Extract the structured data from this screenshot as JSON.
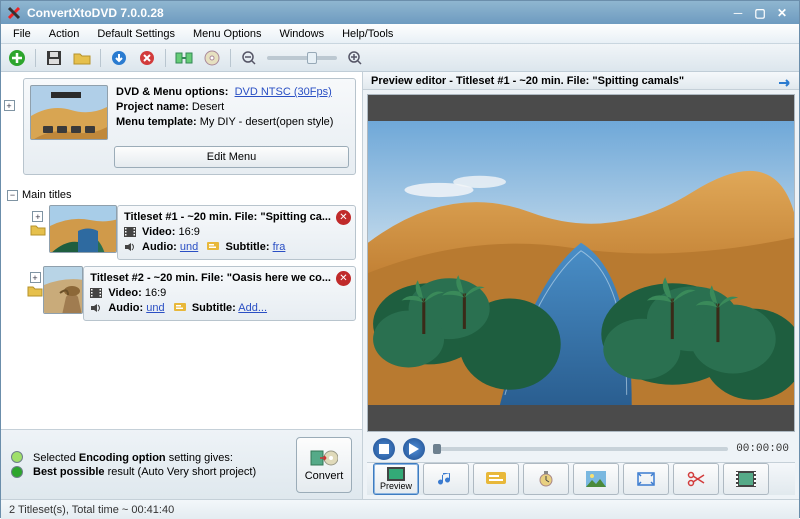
{
  "window": {
    "title": "ConvertXtoDVD 7.0.0.28"
  },
  "menu": {
    "file": "File",
    "action": "Action",
    "default_settings": "Default Settings",
    "menu_options": "Menu Options",
    "windows": "Windows",
    "help_tools": "Help/Tools"
  },
  "dvd": {
    "options_label": "DVD & Menu options:",
    "options_value": "DVD NTSC (30Fps)",
    "project_label": "Project name:",
    "project_value": "Desert",
    "template_label": "Menu template:",
    "template_value": "My  DIY - desert(open style)",
    "edit_menu": "Edit Menu"
  },
  "tree": {
    "main_titles": "Main titles"
  },
  "titlesets": [
    {
      "title": "Titleset #1 - ~20 min. File: \"Spitting ca...",
      "video_label": "Video:",
      "video_value": "16:9",
      "audio_label": "Audio:",
      "audio_value": "und",
      "subtitle_label": "Subtitle:",
      "subtitle_value": "fra"
    },
    {
      "title": "Titleset #2 - ~20 min. File: \"Oasis here we co...",
      "video_label": "Video:",
      "video_value": "16:9",
      "audio_label": "Audio:",
      "audio_value": "und",
      "subtitle_label": "Subtitle:",
      "subtitle_value": "Add..."
    }
  ],
  "encoding": {
    "line1_a": "Selected ",
    "line1_b": "Encoding option",
    "line1_c": " setting gives:",
    "line2_a": "Best possible",
    "line2_b": " result (Auto Very short project)"
  },
  "convert": {
    "label": "Convert"
  },
  "preview": {
    "head": "Preview editor - Titleset #1 - ~20 min. File: \"Spitting camals\"",
    "time": "00:00:00"
  },
  "tabs": {
    "preview": "Preview"
  },
  "status": {
    "text": "2 Titleset(s), Total time ~ 00:41:40"
  }
}
